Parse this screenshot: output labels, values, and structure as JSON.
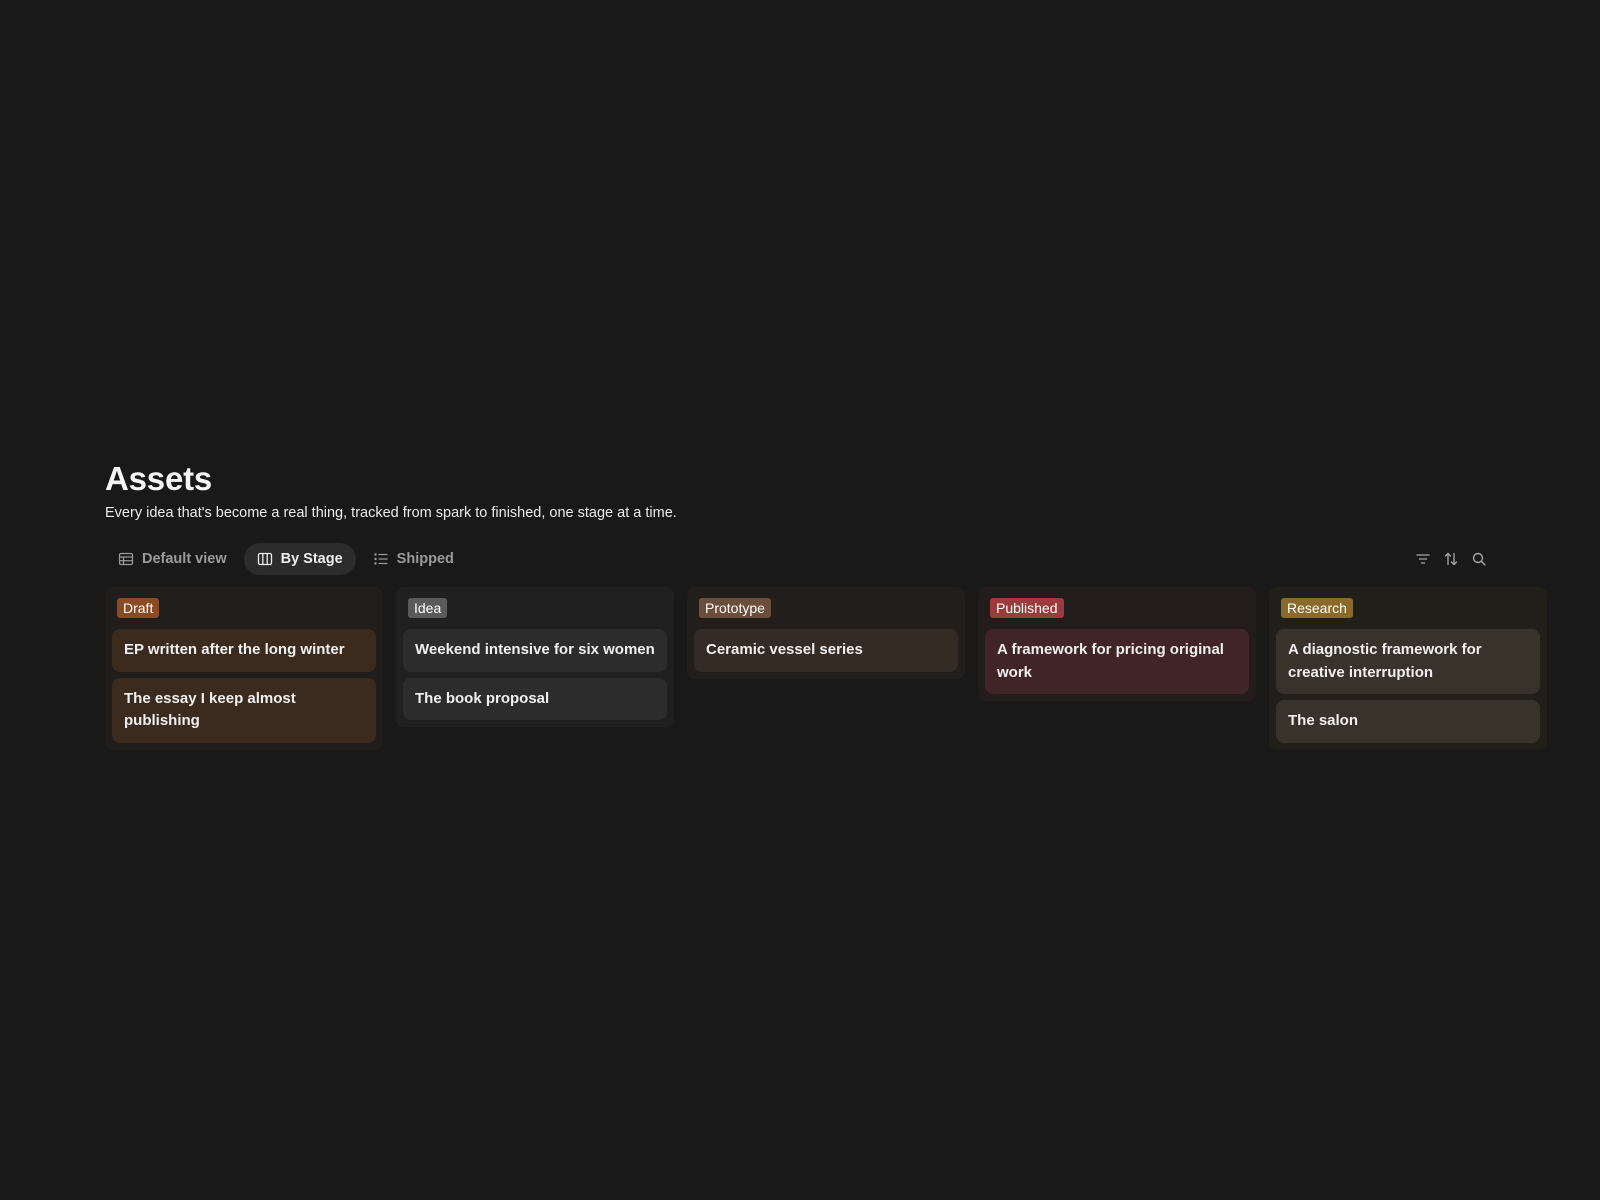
{
  "page": {
    "title": "Assets",
    "description": "Every idea that's become a real thing, tracked from spark to finished, one stage at a time."
  },
  "toolbar": {
    "tabs": [
      {
        "label": "Default view",
        "icon": "table-icon",
        "active": false
      },
      {
        "label": "By Stage",
        "icon": "board-icon",
        "active": true
      },
      {
        "label": "Shipped",
        "icon": "list-icon",
        "active": false
      }
    ],
    "actions": [
      {
        "icon": "filter-icon"
      },
      {
        "icon": "sort-icon"
      },
      {
        "icon": "search-icon"
      }
    ]
  },
  "board": {
    "columns": [
      {
        "name": "Draft",
        "tag_color": "#8a4a23",
        "column_bg": "#211d1b",
        "card_bg": "#3b2a1e",
        "cards": [
          {
            "title": "EP written after the long winter"
          },
          {
            "title": "The essay I keep almost publishing"
          }
        ]
      },
      {
        "name": "Idea",
        "tag_color": "#5a5a5a",
        "column_bg": "#202020",
        "card_bg": "#2c2c2c",
        "cards": [
          {
            "title": "Weekend intensive for six women"
          },
          {
            "title": "The book proposal"
          }
        ]
      },
      {
        "name": "Prototype",
        "tag_color": "#6b4d3b",
        "column_bg": "#211e1c",
        "card_bg": "#342b24",
        "cards": [
          {
            "title": "Ceramic vessel series"
          }
        ]
      },
      {
        "name": "Published",
        "tag_color": "#9b3b3b",
        "column_bg": "#221c1c",
        "card_bg": "#412526",
        "cards": [
          {
            "title": "A framework for pricing original work"
          }
        ]
      },
      {
        "name": "Research",
        "tag_color": "#8a6a2a",
        "column_bg": "#211f1a",
        "card_bg": "#38322a",
        "cards": [
          {
            "title": "A diagnostic framework for creative interruption"
          },
          {
            "title": "The salon"
          }
        ]
      }
    ]
  }
}
